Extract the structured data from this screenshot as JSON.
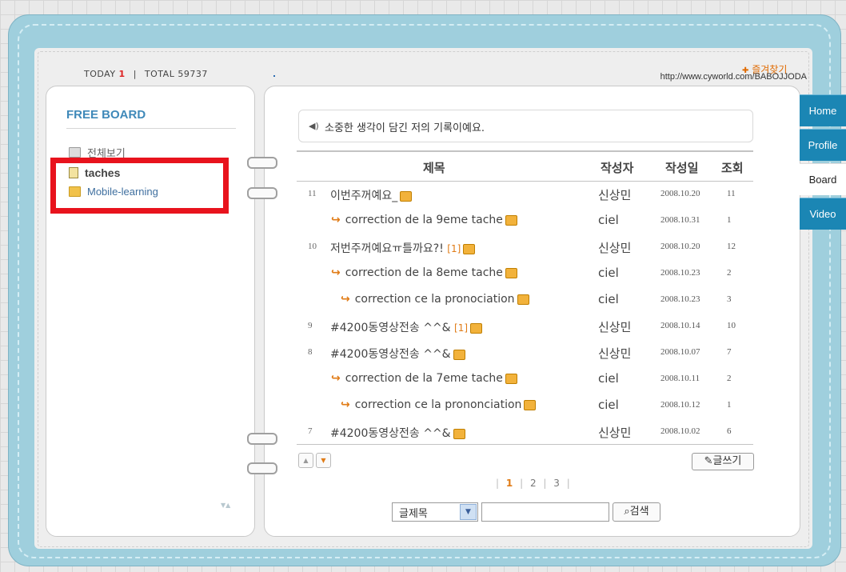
{
  "header": {
    "today_label": "TODAY",
    "today_count": "1",
    "separator": "|",
    "total_label": "TOTAL",
    "total_count": "59737",
    "favorites": "즐겨찾기",
    "url": "http://www.cyworld.com/BABOJJODA"
  },
  "sidebar": {
    "title": "FREE BOARD",
    "folders": [
      {
        "label": "전체보기",
        "icon": "all-view-icon"
      },
      {
        "label": "taches",
        "icon": "note-folder-icon"
      },
      {
        "label": "Mobile-learning",
        "icon": "folder-icon"
      }
    ]
  },
  "board": {
    "message": "소중한 생각이 담긴 저의 기록이예요.",
    "columns": {
      "subject": "제목",
      "author": "작성자",
      "date": "작성일",
      "views": "조회"
    },
    "rows": [
      {
        "no": "11",
        "indent": 0,
        "subject": "이번주꺼예요_",
        "comments": "",
        "author": "신상민",
        "date": "2008.10.20",
        "views": "11"
      },
      {
        "no": "",
        "indent": 1,
        "subject": "correction de la 9eme tache",
        "comments": "",
        "author": "ciel",
        "date": "2008.10.31",
        "views": "1"
      },
      {
        "no": "10",
        "indent": 0,
        "subject": "저번주꺼예요ㅠ틀까요?!",
        "comments": "[1]",
        "author": "신상민",
        "date": "2008.10.20",
        "views": "12"
      },
      {
        "no": "",
        "indent": 1,
        "subject": "correction de la 8eme tache",
        "comments": "",
        "author": "ciel",
        "date": "2008.10.23",
        "views": "2"
      },
      {
        "no": "",
        "indent": 2,
        "subject": "correction ce la pronociation",
        "comments": "",
        "author": "ciel",
        "date": "2008.10.23",
        "views": "3"
      },
      {
        "no": "9",
        "indent": 0,
        "subject": "#4200동영상전송 ^^&",
        "comments": "[1]",
        "author": "신상민",
        "date": "2008.10.14",
        "views": "10"
      },
      {
        "no": "8",
        "indent": 0,
        "subject": "#4200동영상전송 ^^&",
        "comments": "",
        "author": "신상민",
        "date": "2008.10.07",
        "views": "7"
      },
      {
        "no": "",
        "indent": 1,
        "subject": "correction de la 7eme tache",
        "comments": "",
        "author": "ciel",
        "date": "2008.10.11",
        "views": "2"
      },
      {
        "no": "",
        "indent": 2,
        "subject": "correction ce la prononciation",
        "comments": "",
        "author": "ciel",
        "date": "2008.10.12",
        "views": "1"
      },
      {
        "no": "7",
        "indent": 0,
        "subject": "#4200동영상전송 ^^&",
        "comments": "",
        "author": "신상민",
        "date": "2008.10.02",
        "views": "6"
      }
    ],
    "write_label": "글쓰기",
    "pages": [
      "1",
      "2",
      "3"
    ],
    "current_page": "1",
    "search": {
      "select_value": "글제목",
      "button": "검색"
    }
  },
  "tabs": [
    "Home",
    "Profile",
    "Board",
    "Video"
  ],
  "active_tab": "Board",
  "colors": {
    "accent_blue": "#1b86b4",
    "highlight_red": "#e8131d",
    "orange": "#e07b16"
  }
}
